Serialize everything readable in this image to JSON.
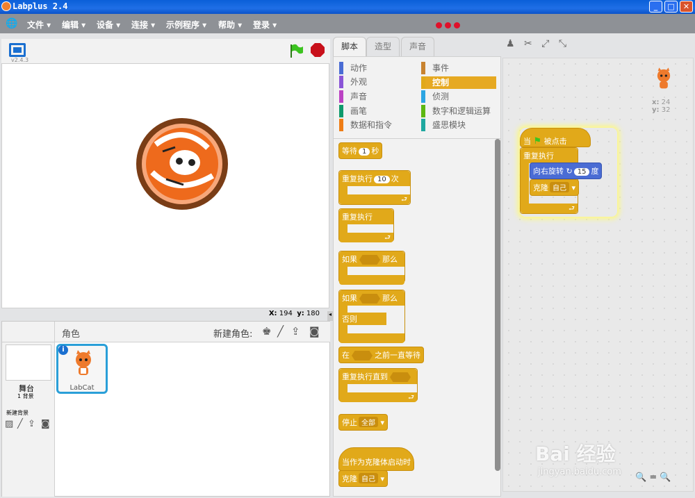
{
  "window": {
    "title": "Labplus 2.4",
    "buttons": [
      "_",
      "□",
      "✕"
    ]
  },
  "menu": {
    "items": [
      "文件 ▾",
      "编辑 ▾",
      "设备 ▾",
      "连接 ▾",
      "示例程序 ▾",
      "帮助 ▾",
      "登录 ▾"
    ]
  },
  "stage": {
    "version": "v2.4.3",
    "coords": {
      "x_label": "X:",
      "x": "194",
      "y_label": "y:",
      "y": "180"
    }
  },
  "sprites": {
    "header": "角色",
    "new_sprite_label": "新建角色:",
    "stage_label": "舞台",
    "backdrops_count": "1 背景",
    "new_backdrop_label": "新建背景",
    "items": [
      {
        "name": "LabCat"
      }
    ]
  },
  "tabs": [
    "脚本",
    "造型",
    "声音"
  ],
  "categories": {
    "left": [
      "动作",
      "外观",
      "声音",
      "画笔",
      "数据和指令"
    ],
    "right": [
      "事件",
      "控制",
      "侦测",
      "数字和逻辑运算",
      "盛思模块"
    ],
    "left_colors": [
      "#4a6cd4",
      "#8a55d7",
      "#bb42c3",
      "#0e9a6c",
      "#ee7d16"
    ],
    "right_colors": [
      "#c88330",
      "#e1a91a",
      "#2ca5e2",
      "#5cb712",
      "#1fa8a0"
    ],
    "selected": "控制"
  },
  "blocks": {
    "wait": {
      "label": "等待",
      "value": "1",
      "unit": "秒"
    },
    "repeat": {
      "label": "重复执行",
      "value": "10",
      "unit": "次"
    },
    "forever": {
      "label": "重复执行"
    },
    "if_then": {
      "label": "如果",
      "then": "那么"
    },
    "if_else": {
      "label": "如果",
      "then": "那么",
      "else": "否则"
    },
    "wait_until": {
      "pre": "在",
      "post": "之前一直等待"
    },
    "repeat_until": {
      "label": "重复执行直到"
    },
    "stop": {
      "label": "停止",
      "option": "全部"
    },
    "clone_start": {
      "label": "当作为克隆体启动时"
    },
    "clone": {
      "label": "克隆",
      "option": "自己"
    }
  },
  "script": {
    "hat_pre": "当",
    "hat_post": "被点击",
    "forever": "重复执行",
    "turn_label": "向右旋转",
    "turn_value": "15",
    "turn_unit": "度",
    "clone_label": "克隆",
    "clone_option": "自己"
  },
  "sprite_info": {
    "x_label": "x:",
    "x": "24",
    "y_label": "y:",
    "y": "32"
  },
  "watermark": {
    "line1": "Bai 经验",
    "line2": "jingyan.baidu.com"
  }
}
